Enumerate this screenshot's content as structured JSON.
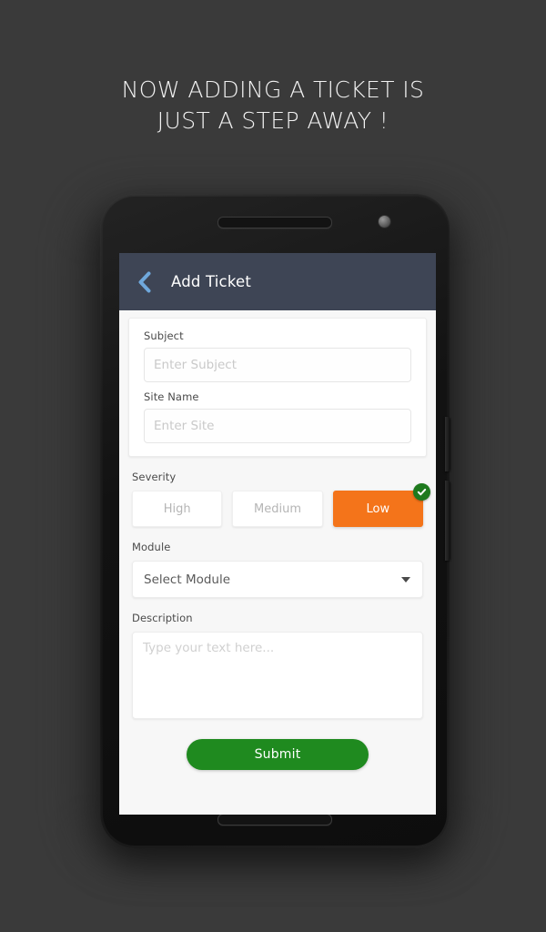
{
  "promo": {
    "headline": "NOW ADDING A TICKET IS\nJUST A STEP AWAY !"
  },
  "colors": {
    "page_background": "#3a3a3a",
    "appbar": "#3e4555",
    "back_icon": "#6fa8dc",
    "accent_orange": "#f4741a",
    "submit_green": "#1f8a1f",
    "check_green": "#1e7a1e",
    "screen_background": "#f7f7f7"
  },
  "appbar": {
    "back_icon": "chevron-left-icon",
    "title": "Add Ticket"
  },
  "form": {
    "subject": {
      "label": "Subject",
      "placeholder": "Enter Subject",
      "value": ""
    },
    "site_name": {
      "label": "Site Name",
      "placeholder": "Enter Site",
      "value": ""
    },
    "severity": {
      "label": "Severity",
      "options": [
        {
          "label": "High",
          "selected": false
        },
        {
          "label": "Medium",
          "selected": false
        },
        {
          "label": "Low",
          "selected": true
        }
      ],
      "selected_value": "Low",
      "selected_badge_icon": "check-circle-icon"
    },
    "module": {
      "label": "Module",
      "placeholder": "Select Module",
      "value": "Select Module",
      "caret_icon": "chevron-down-icon"
    },
    "description": {
      "label": "Description",
      "placeholder": "Type your text here...",
      "value": ""
    },
    "submit": {
      "label": "Submit"
    }
  },
  "device": {
    "top_speaker_icon": "speaker-grille-icon",
    "bottom_speaker_icon": "speaker-grille-icon",
    "camera_icon": "front-camera-icon",
    "power_button_icon": "power-button",
    "volume_button_icon": "volume-button"
  }
}
